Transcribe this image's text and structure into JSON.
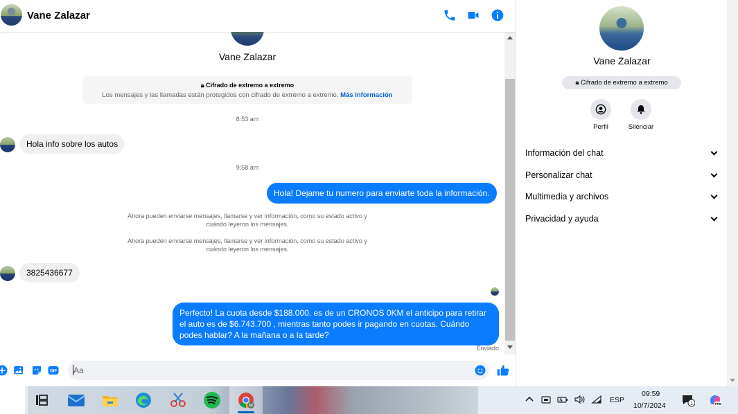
{
  "header": {
    "contact_name": "Vane Zalazar",
    "icons": [
      "phone-icon",
      "video-icon",
      "info-icon"
    ]
  },
  "conversation": {
    "top_name": "Vane Zalazar",
    "encryption_title": "Cifrado de extremo a extremo",
    "encryption_desc": "Los mensajes y las llamadas están protegidos con cifrado de extremo a extremo.",
    "encryption_link": "Más información",
    "time1": "8:53 am",
    "msg1": "Hola info sobre los autos",
    "time2": "9:58 am",
    "msg2": "Hola! Dejame tu numero  para enviarte toda la información.",
    "system1": "Ahora pueden enviarse mensajes, llamarse y ver información, como su estado activo y cuándo leyeron los mensajes.",
    "system2": "Ahora pueden enviarse mensajes, llamarse y ver información, como su estado activo y cuándo leyeron los mensajes.",
    "msg3": "3825436677",
    "msg4": "Perfecto! La cuota desde $188.000. es de un CRONOS 0KM el anticipo para retirar el auto es de $6.743.700 , mientras tanto podes ir pagando en cuotas. Cuándo podes hablar? A la mañana o a la tarde?",
    "sent_status": "Enviado"
  },
  "composer": {
    "placeholder": "Aa",
    "icons": [
      "add-icon",
      "photo-icon",
      "sticker-icon",
      "gif-icon",
      "emoji-icon",
      "like-icon"
    ]
  },
  "right_panel": {
    "name": "Vane Zalazar",
    "encryption_badge": "Cifrado de extremo a extremo",
    "actions": [
      {
        "label": "Perfil",
        "icon": "profile-icon"
      },
      {
        "label": "Silenciar",
        "icon": "bell-icon"
      }
    ],
    "sections": [
      "Información del chat",
      "Personalizar chat",
      "Multimedia y archivos",
      "Privacidad y ayuda"
    ]
  },
  "taskbar": {
    "apps": [
      "task-view-icon",
      "mail-icon",
      "file-explorer-icon",
      "edge-icon",
      "snipping-tool-icon",
      "spotify-icon",
      "chrome-icon"
    ],
    "language": "ESP",
    "time": "09:59",
    "date": "10/7/2024",
    "notification_count": "1",
    "chrome_badge": "M",
    "copilot_badge": "PRE",
    "gif_label": "GIF"
  },
  "colors": {
    "accent": "#0a7cff",
    "link": "#0064d1",
    "bubble_in": "#f0f0f0",
    "muted_text": "#65676b"
  }
}
